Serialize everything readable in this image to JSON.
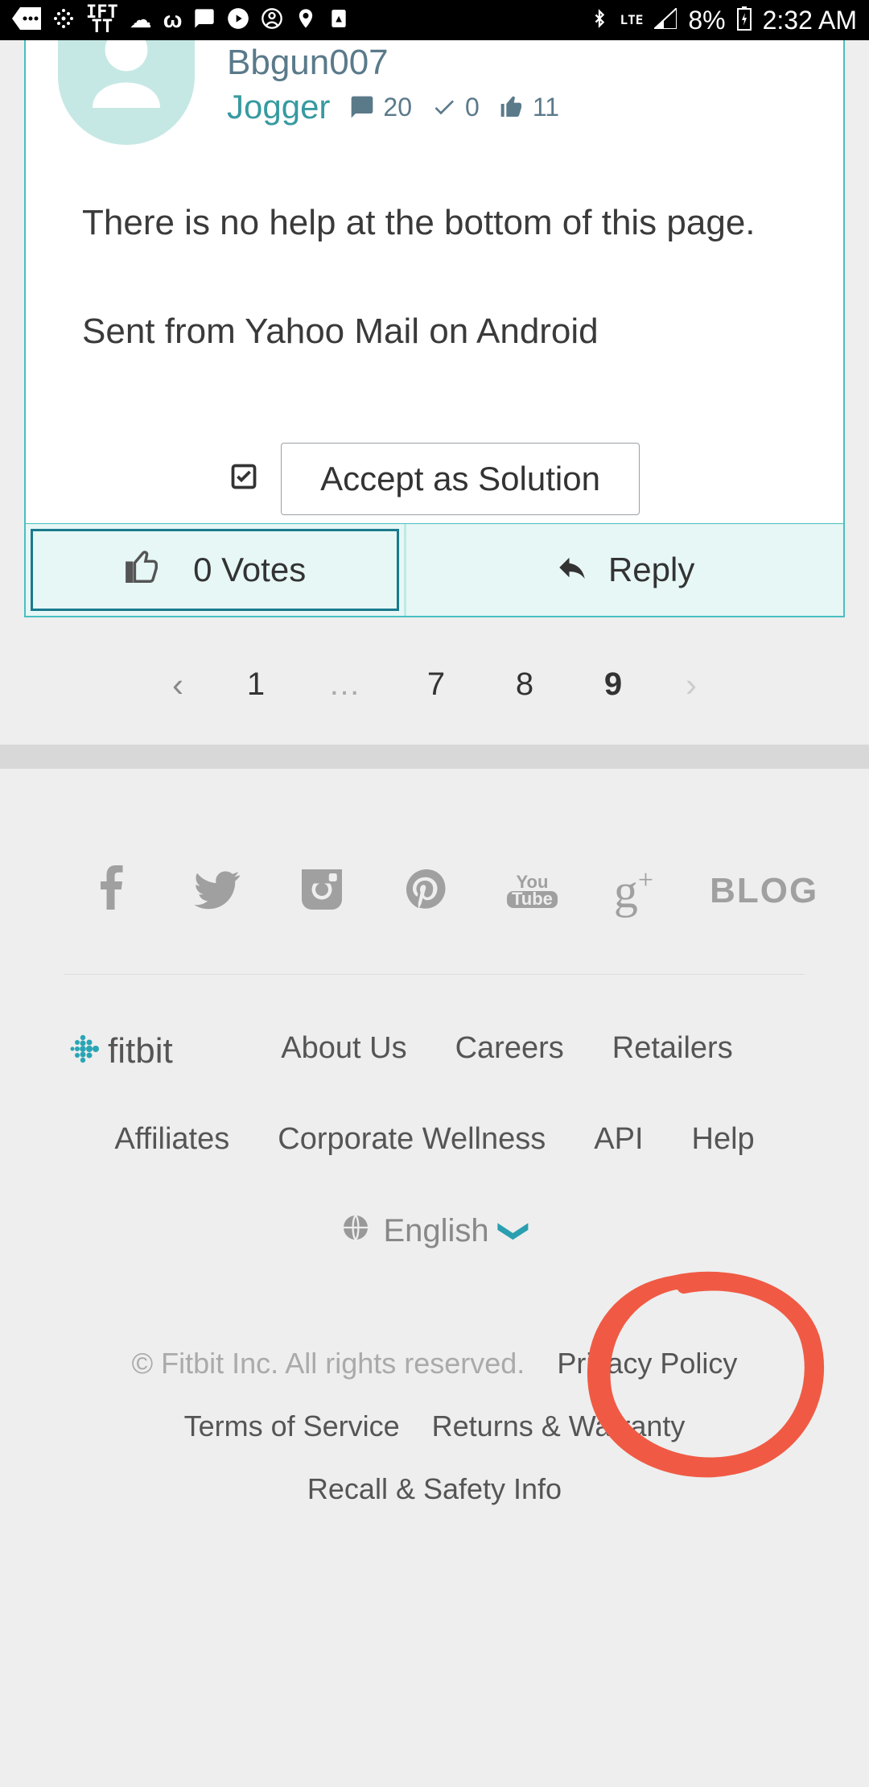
{
  "statusbar": {
    "ift": "IFT\nTT",
    "lte": "LTE",
    "battery": "8%",
    "time": "2:32 AM"
  },
  "post": {
    "username": "Bbgun007",
    "rank": "Jogger",
    "stats": {
      "comments": "20",
      "solutions": "0",
      "likes": "11"
    },
    "body_p1": "There is no help at the bottom of this page.",
    "body_p2": "Sent from Yahoo Mail on Android",
    "accept_label": "Accept as Solution",
    "votes_label": "0 Votes",
    "reply_label": "Reply"
  },
  "pagination": {
    "first": "1",
    "ellipsis": "…",
    "p7": "7",
    "p8": "8",
    "p9": "9"
  },
  "social": {
    "blog": "BLOG",
    "yt_you": "You",
    "yt_tube": "Tube"
  },
  "footer": {
    "brand": "fitbit",
    "about": "About Us",
    "careers": "Careers",
    "retailers": "Retailers",
    "affiliates": "Affiliates",
    "wellness": "Corporate Wellness",
    "api": "API",
    "help": "Help",
    "language": "English",
    "copyright": "© Fitbit Inc. All rights reserved.",
    "privacy": "Privacy Policy",
    "tos": "Terms of Service",
    "returns": "Returns & Warranty",
    "recall": "Recall & Safety Info"
  }
}
